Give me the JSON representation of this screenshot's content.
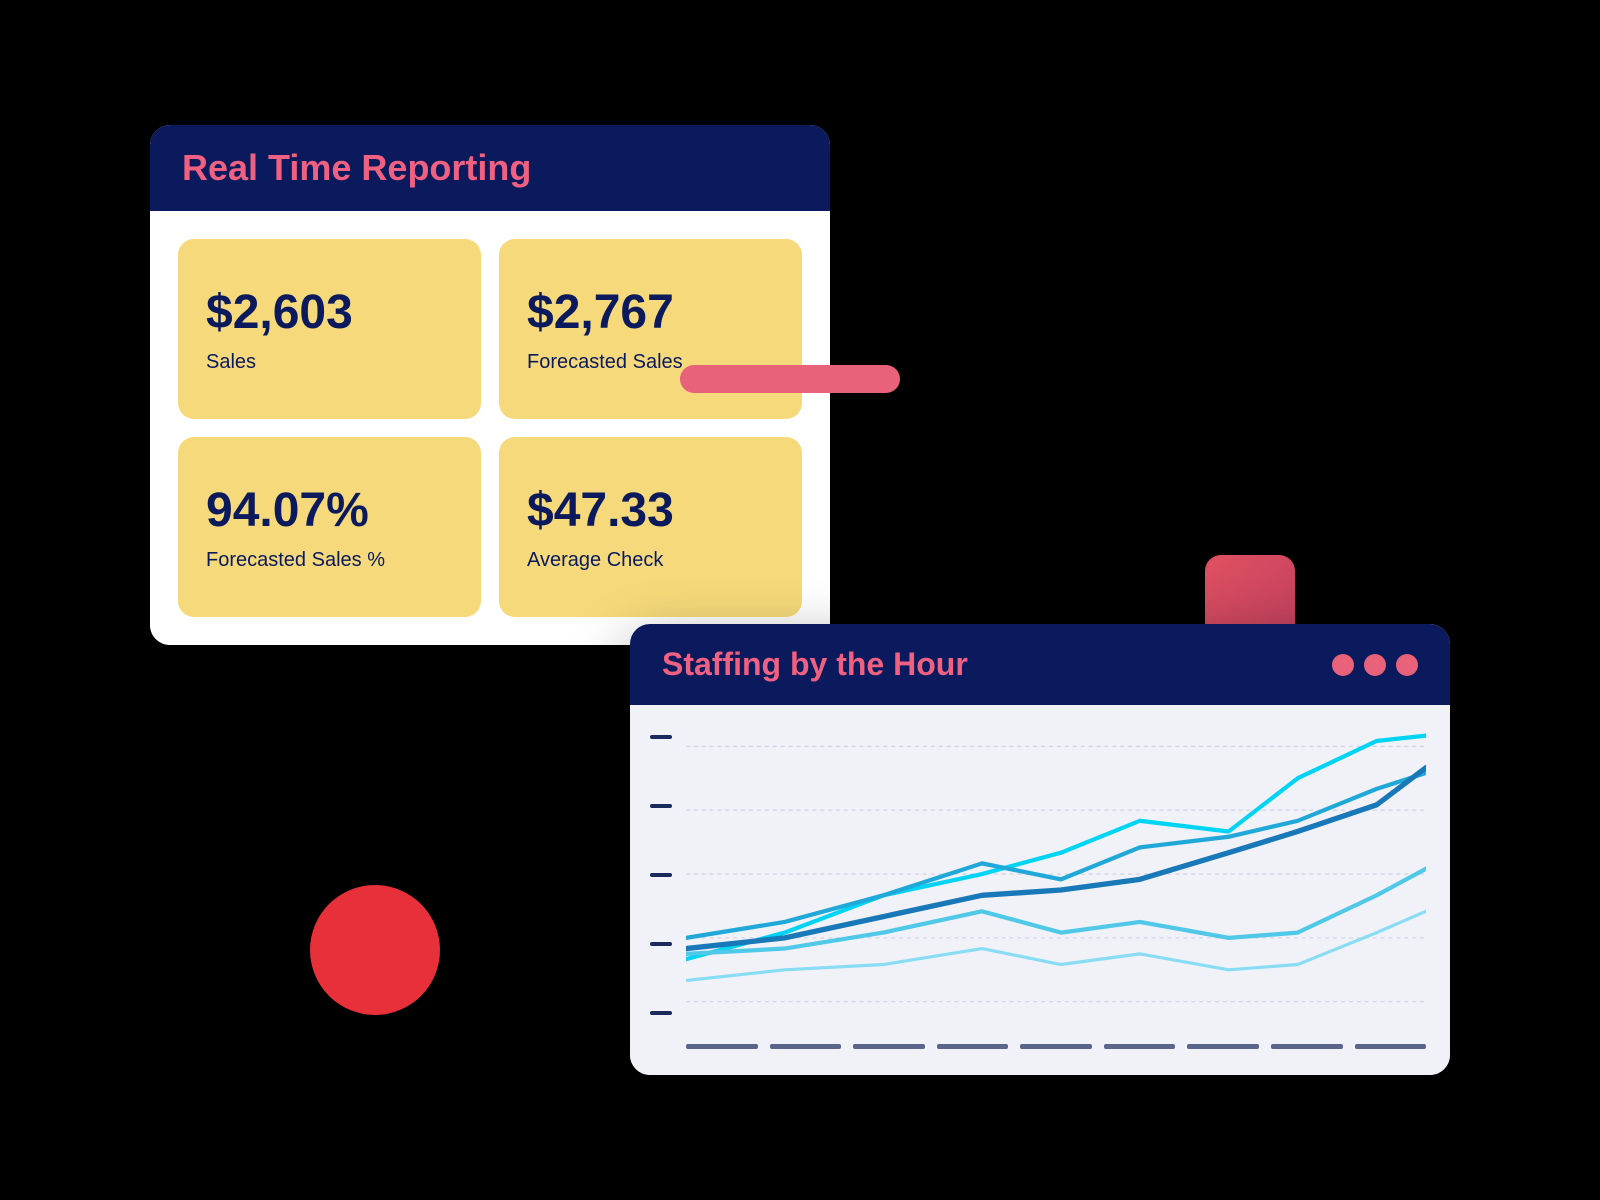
{
  "reporting": {
    "title": "Real Time Reporting",
    "metrics": [
      {
        "id": "sales",
        "value": "$2,603",
        "label": "Sales"
      },
      {
        "id": "forecasted-sales",
        "value": "$2,767",
        "label": "Forecasted Sales"
      },
      {
        "id": "forecasted-pct",
        "value": "94.07%",
        "label": "Forecasted Sales %"
      },
      {
        "id": "avg-check",
        "value": "$47.33",
        "label": "Average Check"
      }
    ]
  },
  "staffing": {
    "title": "Staffing by the Hour",
    "window_controls": [
      "dot1",
      "dot2",
      "dot3"
    ]
  },
  "decorative": {
    "circle_color": "#e8303a",
    "connector_color": "#e8627a",
    "rect_color_gradient_start": "#e05060",
    "rect_color_gradient_end": "#c04060"
  }
}
